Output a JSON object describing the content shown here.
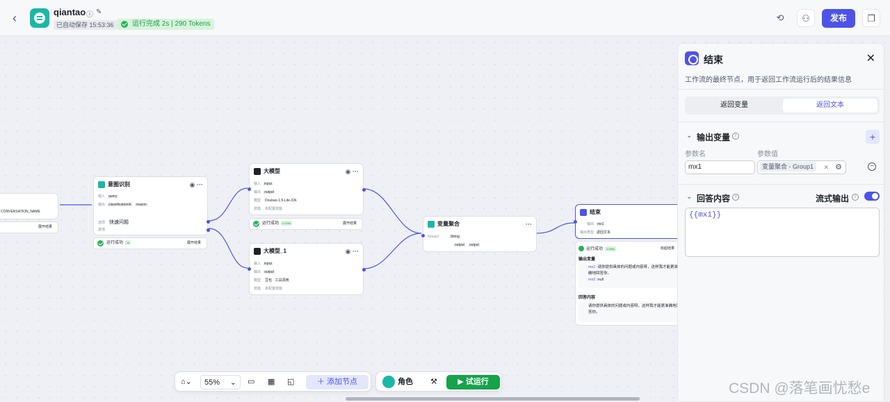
{
  "topbar": {
    "app_name": "qiantao",
    "autosave": "已自动保存 15:53:36",
    "run_status": "运行完成 2s | 290 Tokens",
    "publish_label": "发布"
  },
  "nodes": {
    "start": {
      "var": "CONVERSATION_NAME",
      "expand": "展开结果"
    },
    "intent": {
      "title": "意图识别",
      "in_label": "输入",
      "in_var": "query",
      "out_label": "输出",
      "out_var1": "classificationId",
      "out_var2": "reason",
      "option_label": "选项",
      "option_value": "快速问题",
      "other_label": "其他",
      "status": "运行成功",
      "time": "1s",
      "expand": "展开结果"
    },
    "llm1": {
      "title": "大模型",
      "in_label": "输入",
      "in_var": "input",
      "out_label": "输出",
      "out_var": "output",
      "model_label": "模型",
      "model": "Doubao-1.5-Lite-32k",
      "skill_label": "技能",
      "skill": "未配置技能",
      "status": "运行成功",
      "time": "0.403s",
      "expand": "展开结果"
    },
    "llm2": {
      "title": "大模型_1",
      "in_label": "输入",
      "in_var": "input",
      "out_label": "输出",
      "out_var": "output",
      "model_label": "模型",
      "model": "豆包 · 工具调用",
      "skill_label": "技能",
      "skill": "未配置技能"
    },
    "agg": {
      "title": "变量聚合",
      "group": "Group1",
      "type": "String",
      "var1": "output",
      "var2": "output"
    },
    "end": {
      "title": "结束",
      "out_label": "输出",
      "out_var": "mx1",
      "type_label": "输出类型",
      "type_value": "返回文本",
      "status": "运行成功",
      "time": "0.598s",
      "collapse": "收起结果",
      "outvars_title": "输出变量",
      "mx1_label": "mx1 :",
      "mx1_value": "请你提供具体的问题或内容呀，这样我才能更准确地回答你。",
      "mx2_label": "mx2 :",
      "mx2_value": "null",
      "answer_title": "回答内容",
      "answer_value": "请你提供具体的问题或内容呀，这样我才能更准确地回答你。"
    }
  },
  "panel": {
    "title": "结束",
    "description": "工作流的最终节点，用于返回工作流运行后的结果信息",
    "tabs": [
      "返回变量",
      "返回文本"
    ],
    "active_tab": 1,
    "output_section": "输出变量",
    "param_name_label": "参数名",
    "param_value_label": "参数值",
    "param_name": "mx1",
    "param_value": "变量聚合 - Group1",
    "answer_section": "回答内容",
    "stream_label": "流式输出",
    "stream_on": true,
    "answer_text": "{{mx1}}"
  },
  "bottom": {
    "zoom": "55%",
    "add_node": "添加节点",
    "role": "角色",
    "test_run": "试运行"
  },
  "watermark": "CSDN @落笔画忧愁e",
  "colors": {
    "accent": "#4d53e8",
    "success": "#22b45b",
    "intent": "#1ab8a8"
  }
}
